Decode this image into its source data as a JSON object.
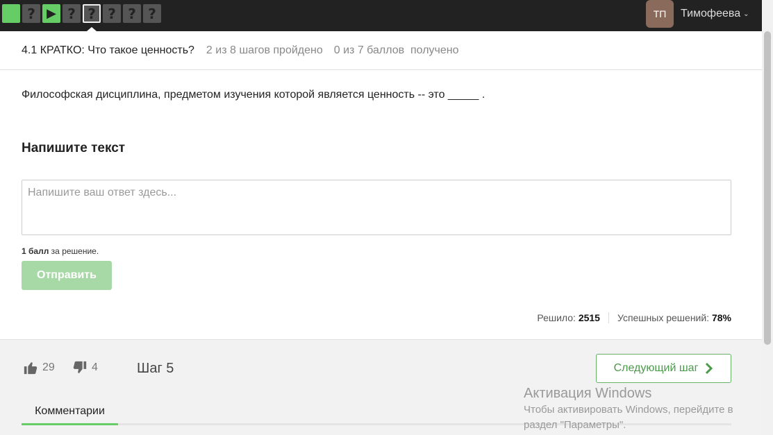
{
  "topbar": {
    "steps": [
      {
        "type": "done",
        "icon": ""
      },
      {
        "type": "quiz",
        "icon": "?"
      },
      {
        "type": "video",
        "icon": "▶"
      },
      {
        "type": "quiz",
        "icon": "?"
      },
      {
        "type": "quiz-active",
        "icon": "?"
      },
      {
        "type": "quiz",
        "icon": "?"
      },
      {
        "type": "quiz",
        "icon": "?"
      },
      {
        "type": "quiz",
        "icon": "?"
      }
    ],
    "avatar_initials": "ТП",
    "username": "Тимофеева"
  },
  "lesson": {
    "title": "4.1 КРАТКО: Что такое ценность?",
    "progress": "2 из 8 шагов пройдено",
    "score": "0 из 7 баллов  получено"
  },
  "question": "Философская дисциплина, предметом изучения которой является ценность -- это _____ .",
  "answer": {
    "title": "Напишите текст",
    "placeholder": "Напишите ваш ответ здесь...",
    "value": "",
    "points_bold": "1 балл",
    "points_rest": " за решение.",
    "submit_label": "Отправить"
  },
  "stats": {
    "solved_label": "Решило: ",
    "solved_value": "2515",
    "success_label": "Успешных решений: ",
    "success_value": "78%"
  },
  "footer": {
    "likes": "29",
    "dislikes": "4",
    "step_label": "Шаг 5",
    "next_label": "Следующий шаг",
    "comments_tab": "Комментарии"
  },
  "watermark": {
    "title": "Активация Windows",
    "line1": "Чтобы активировать Windows, перейдите в",
    "line2": "раздел \"Параметры\"."
  },
  "colors": {
    "green": "#66cc66",
    "topbar": "#222222"
  }
}
